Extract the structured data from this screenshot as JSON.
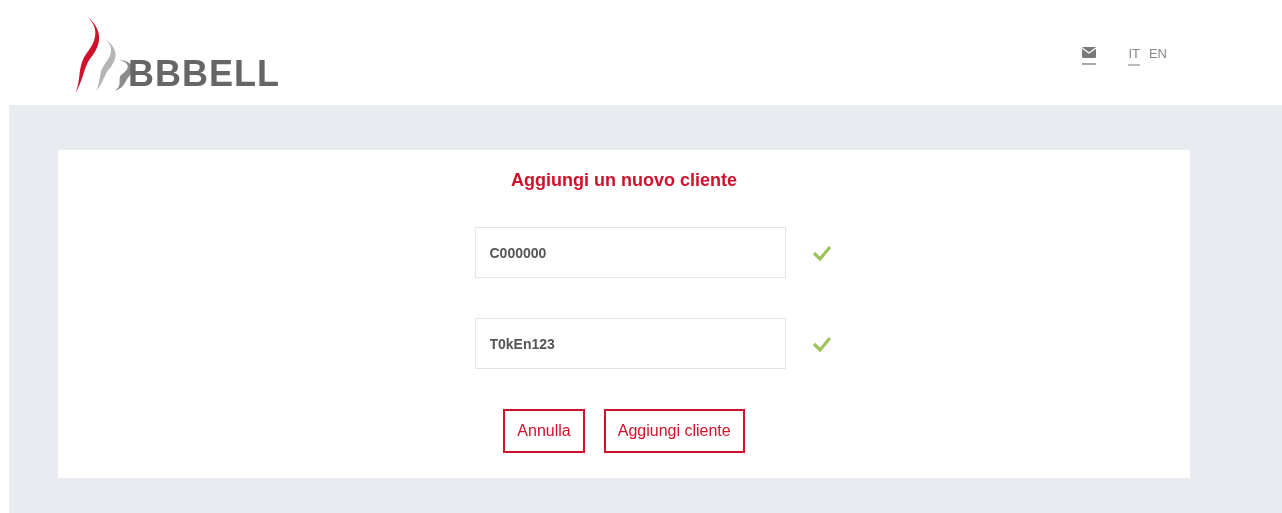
{
  "header": {
    "logo_text": "BBBELL",
    "languages": [
      {
        "label": "IT",
        "selected": true
      },
      {
        "label": "EN",
        "selected": false
      }
    ]
  },
  "form": {
    "title": "Aggiungi un nuovo cliente",
    "fields": [
      {
        "value": "C000000",
        "valid": true
      },
      {
        "value": "T0kEn123",
        "valid": true
      }
    ],
    "buttons": [
      "Annulla",
      "Aggiungi cliente"
    ]
  }
}
